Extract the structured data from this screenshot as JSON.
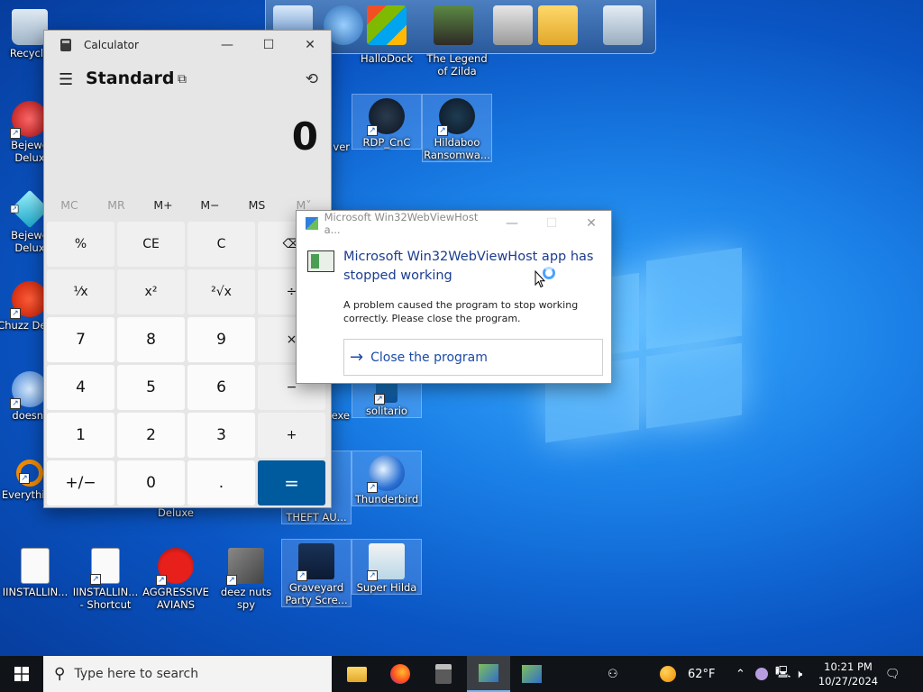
{
  "desktop": {
    "icons": [
      {
        "label": "Recycle"
      },
      {
        "label": "Bejewe Delux"
      },
      {
        "label": "Bejewe Delux"
      },
      {
        "label": "Chuzz Delux"
      },
      {
        "label": "doesnt"
      },
      {
        "label": "Everything"
      },
      {
        "label": "IINSTALLIN..."
      },
      {
        "label": "IINSTALLIN... - Shortcut"
      },
      {
        "label": "AGGRESSIVE AVIANS"
      },
      {
        "label": "deez nuts spy"
      },
      {
        "label": "HalloDock"
      },
      {
        "label": "The Legend of Zilda"
      },
      {
        "label": "RDP_CnC"
      },
      {
        "label": "Hildaboo Ransomwa..."
      },
      {
        "label": "solitario"
      },
      {
        "label": "Thunderbird"
      },
      {
        "label": "THEFT AU..."
      },
      {
        "label": "Graveyard Party Scre..."
      },
      {
        "label": "Super Hilda"
      },
      {
        "label": "Deluxe"
      },
      {
        "label": "ver"
      },
      {
        "label": "exe"
      }
    ]
  },
  "calculator": {
    "title": "Calculator",
    "mode": "Standard",
    "display": "0",
    "memory": [
      "MC",
      "MR",
      "M+",
      "M−",
      "MS",
      "M˅"
    ],
    "keys": [
      "%",
      "CE",
      "C",
      "⌫",
      "⅟x",
      "x²",
      "²√x",
      "÷",
      "7",
      "8",
      "9",
      "×",
      "4",
      "5",
      "6",
      "−",
      "1",
      "2",
      "3",
      "+",
      "+/−",
      "0",
      ".",
      "="
    ],
    "colors": {
      "equals": "#005a9e"
    }
  },
  "dialog": {
    "title": "Microsoft Win32WebViewHost a...",
    "heading": "Microsoft Win32WebViewHost app has stopped working",
    "message": "A problem caused the program to stop working correctly. Please close the program.",
    "action": "Close the program"
  },
  "taskbar": {
    "search_placeholder": "Type here to search",
    "weather": "62°F",
    "time": "10:21 PM",
    "date": "10/27/2024"
  }
}
